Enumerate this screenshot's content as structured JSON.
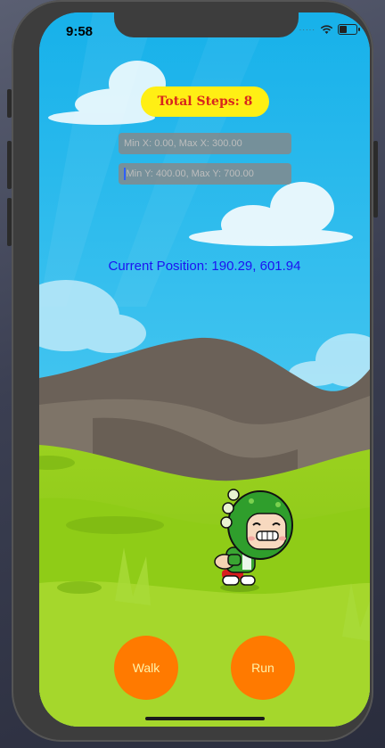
{
  "status_bar": {
    "time": "9:58",
    "signal_dots": "·····",
    "battery_level": 0.45
  },
  "hud": {
    "total_steps_label": "Total Steps: 8",
    "x_range_placeholder": "Min X: 0.00, Max X: 300.00",
    "y_range_placeholder": "Min Y: 400.00, Max Y: 700.00",
    "position_text": "Current Position: 190.29, 601.94"
  },
  "controls": {
    "walk_label": "Walk",
    "run_label": "Run"
  },
  "colors": {
    "sky": "#29b7ec",
    "pill": "#ffef14",
    "pill_text": "#d8261d",
    "position_text": "#1c13f0",
    "button": "#ff7a00",
    "button_text": "#fff3a8"
  },
  "icons": [
    "wifi-icon",
    "battery-icon"
  ]
}
